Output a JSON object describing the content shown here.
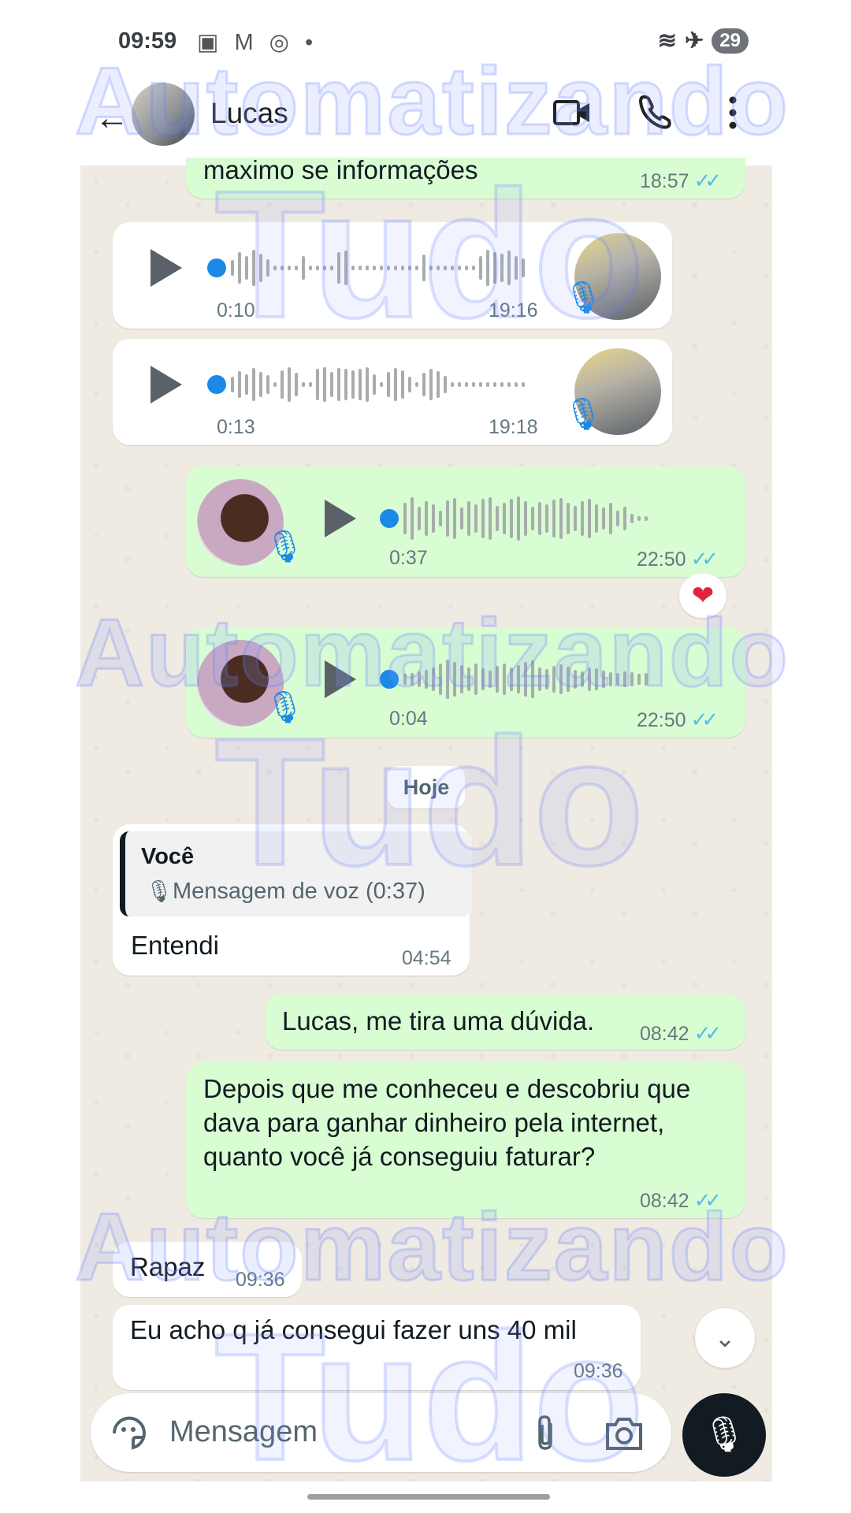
{
  "status_bar": {
    "time": "09:59",
    "battery": "29"
  },
  "header": {
    "contact_name": "Lucas"
  },
  "messages": {
    "m0": {
      "text": "maximo se informações",
      "time": "18:57"
    },
    "v1": {
      "duration": "0:10",
      "time": "19:16"
    },
    "v2": {
      "duration": "0:13",
      "time": "19:18"
    },
    "v3": {
      "duration": "0:37",
      "time": "22:50",
      "reaction": "❤"
    },
    "v4": {
      "duration": "0:04",
      "time": "22:50"
    },
    "date_chip": "Hoje",
    "reply": {
      "quote_author": "Você",
      "quote_text": "Mensagem de voz (0:37)",
      "text": "Entendi",
      "time": "04:54"
    },
    "m5": {
      "text": "Lucas, me tira uma dúvida.",
      "time": "08:42"
    },
    "m6": {
      "text": "Depois que me conheceu e descobriu que dava para ganhar dinheiro pela internet, quanto você já conseguiu faturar?",
      "time": "08:42"
    },
    "m7": {
      "text": "Rapaz",
      "time": "09:36"
    },
    "m8": {
      "text": "Eu acho q já consegui fazer uns 40 mil",
      "time": "09:36"
    }
  },
  "composer": {
    "placeholder": "Mensagem"
  },
  "watermark": {
    "line1": "Automatizando",
    "line2": "Tudo"
  },
  "colors": {
    "outgoing": "#d9fdd3",
    "incoming": "#ffffff",
    "chat_bg": "#efeae2",
    "ticks": "#53bdeb",
    "voice_dot": "#1b8ae6"
  },
  "icons": [
    "back-arrow-icon",
    "video-call-icon",
    "phone-icon",
    "more-vert-icon",
    "play-icon",
    "mic-icon",
    "double-check-icon",
    "heart-icon",
    "chevron-double-down-icon",
    "sticker-icon",
    "attach-icon",
    "camera-icon"
  ]
}
